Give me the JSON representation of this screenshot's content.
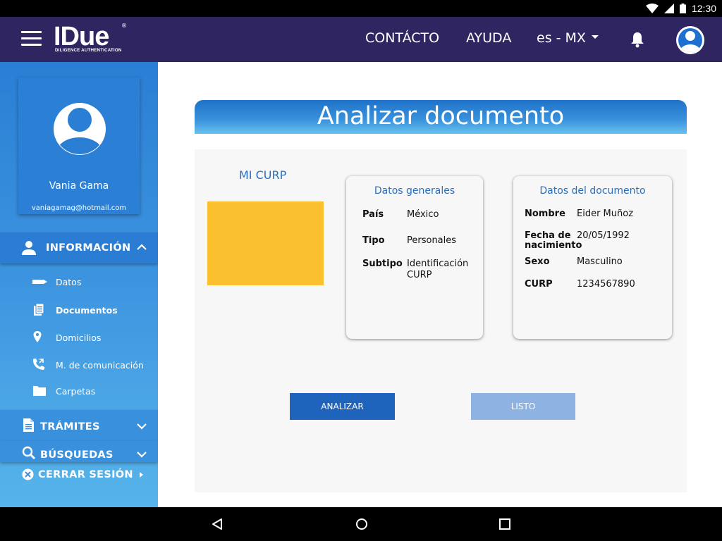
{
  "status_bar": {
    "time": "12:30"
  },
  "header": {
    "logo": "IDue",
    "logo_registered": "®",
    "logo_tagline": "DILIGENCE AUTHENTICATION",
    "contact_label": "CONTÁCTO",
    "help_label": "AYUDA",
    "language": "es - MX"
  },
  "sidebar": {
    "profile": {
      "name": "Vania Gama",
      "email": "vaniagamag@hotmail.com"
    },
    "info_section": "INFORMACIÓN",
    "info_items": [
      {
        "label": "Datos"
      },
      {
        "label": "Documentos"
      },
      {
        "label": "Domicilios"
      },
      {
        "label": "M. de comunicación"
      },
      {
        "label": "Carpetas"
      }
    ],
    "tramites_section": "TRÁMITES",
    "busquedas_section": "BÚSQUEDAS",
    "logout_label": "CERRAR SESIÓN"
  },
  "main": {
    "title": "Analizar documento",
    "document_title": "MI CURP",
    "general_card": {
      "title": "Datos generales",
      "rows": [
        {
          "label": "País",
          "value": "México"
        },
        {
          "label": "Tipo",
          "value": "Personales"
        },
        {
          "label": "Subtipo",
          "value": "Identificación CURP"
        }
      ]
    },
    "document_card": {
      "title": "Datos del documento",
      "rows": [
        {
          "label": "Nombre",
          "value": "Eider Muñoz"
        },
        {
          "label": "Fecha de nacimiento",
          "value": "20/05/1992"
        },
        {
          "label": "Sexo",
          "value": "Masculino"
        },
        {
          "label": "CURP",
          "value": "1234567890"
        }
      ]
    },
    "analyze_button": "ANALIZAR",
    "done_button": "LISTO"
  },
  "colors": {
    "header_bg": "#2f2561",
    "sidebar_top": "#2a7ed4",
    "sidebar_bottom": "#57b4ea",
    "accent_text": "#2a6fbd",
    "primary_button": "#1e63bc",
    "disabled_button": "#8eb3e2",
    "document_placeholder": "#fbc02d"
  },
  "icons": [
    "wifi-icon",
    "signal-icon",
    "battery-icon",
    "menu-icon",
    "bell-icon",
    "user-avatar-icon",
    "person-icon",
    "chevron-up-icon",
    "chevron-down-icon",
    "tag-icon",
    "documents-icon",
    "location-pin-icon",
    "phone-icon",
    "folder-icon",
    "file-icon",
    "search-icon",
    "close-circle-icon",
    "back-icon",
    "home-icon",
    "recents-icon"
  ]
}
